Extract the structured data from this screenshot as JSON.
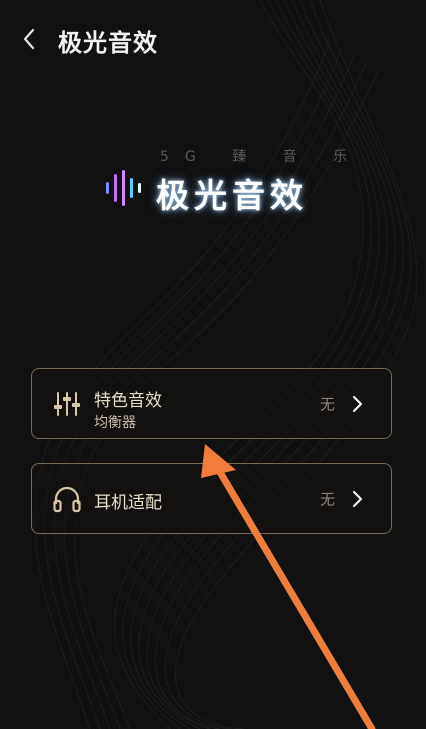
{
  "header": {
    "title": "极光音效",
    "back_icon": "chevron-left-icon"
  },
  "logo": {
    "subtitle": "5G 臻 音 乐",
    "text": "极光音效",
    "wave_colors": [
      "#6b8cff",
      "#c86bff",
      "#5ad0ff",
      "#ffffff"
    ]
  },
  "items": [
    {
      "title": "特色音效",
      "subtitle": "均衡器",
      "value": "无",
      "icon": "equalizer-icon"
    },
    {
      "title": "耳机适配",
      "subtitle": "",
      "value": "无",
      "icon": "headphones-icon"
    }
  ],
  "colors": {
    "background": "#111111",
    "card_border": "#7a6a55",
    "card_text": "#e8dccb",
    "annotation_arrow": "#f07e3a"
  }
}
